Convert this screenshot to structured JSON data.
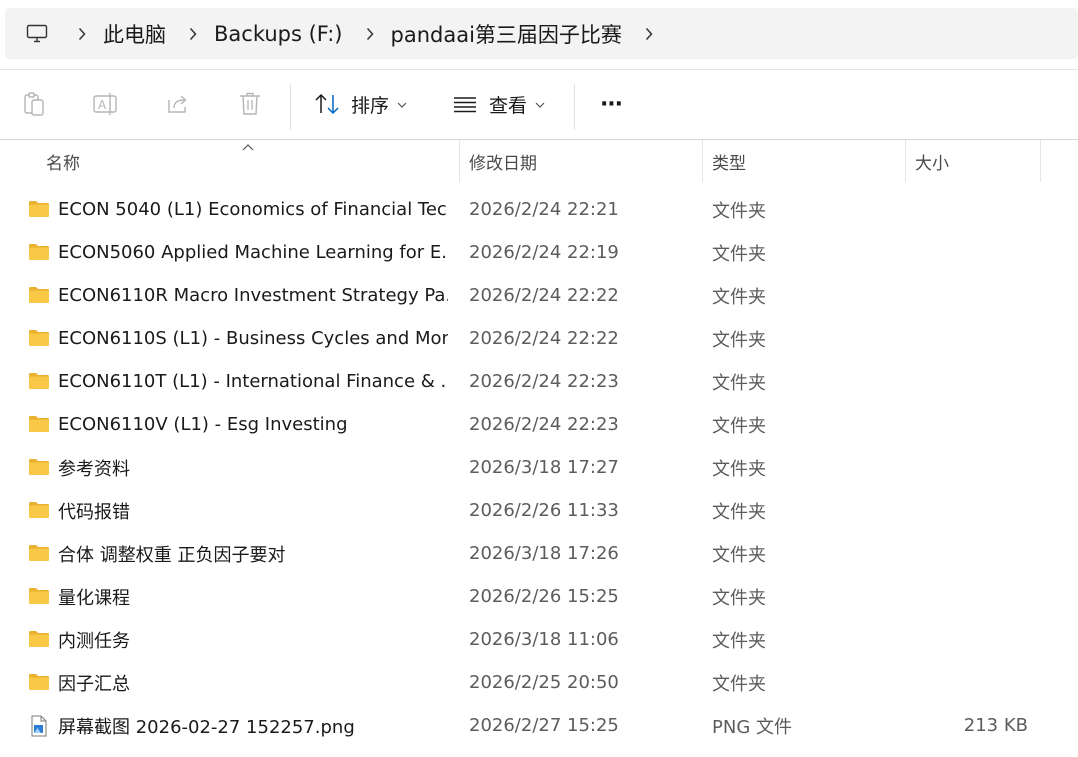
{
  "address": {
    "root_icon": "computer-icon",
    "crumbs": [
      "此电脑",
      "Backups (F:)",
      "pandaai第三届因子比赛"
    ]
  },
  "toolbar": {
    "copy_icon": "clipboard-icon",
    "rename_icon": "rename-icon",
    "share_icon": "share-icon",
    "delete_icon": "trash-icon",
    "sort_label": "排序",
    "view_label": "查看",
    "more_label": "···"
  },
  "columns": {
    "name": "名称",
    "date": "修改日期",
    "type": "类型",
    "size": "大小"
  },
  "files": [
    {
      "name": "ECON 5040 (L1) Economics of Financial Tec...",
      "date": "2026/2/24 22:21",
      "type": "文件夹",
      "size": "",
      "kind": "folder"
    },
    {
      "name": "ECON5060 Applied Machine Learning for E...",
      "date": "2026/2/24 22:19",
      "type": "文件夹",
      "size": "",
      "kind": "folder"
    },
    {
      "name": "ECON6110R Macro Investment Strategy Pa...",
      "date": "2026/2/24 22:22",
      "type": "文件夹",
      "size": "",
      "kind": "folder"
    },
    {
      "name": "ECON6110S (L1) - Business Cycles and Mon...",
      "date": "2026/2/24 22:22",
      "type": "文件夹",
      "size": "",
      "kind": "folder"
    },
    {
      "name": "ECON6110T (L1) - International Finance & ...",
      "date": "2026/2/24 22:23",
      "type": "文件夹",
      "size": "",
      "kind": "folder"
    },
    {
      "name": "ECON6110V (L1) - Esg Investing",
      "date": "2026/2/24 22:23",
      "type": "文件夹",
      "size": "",
      "kind": "folder"
    },
    {
      "name": "参考资料",
      "date": "2026/3/18 17:27",
      "type": "文件夹",
      "size": "",
      "kind": "folder"
    },
    {
      "name": "代码报错",
      "date": "2026/2/26 11:33",
      "type": "文件夹",
      "size": "",
      "kind": "folder"
    },
    {
      "name": "合体 调整权重 正负因子要对",
      "date": "2026/3/18 17:26",
      "type": "文件夹",
      "size": "",
      "kind": "folder"
    },
    {
      "name": "量化课程",
      "date": "2026/2/26 15:25",
      "type": "文件夹",
      "size": "",
      "kind": "folder"
    },
    {
      "name": "内测任务",
      "date": "2026/3/18 11:06",
      "type": "文件夹",
      "size": "",
      "kind": "folder"
    },
    {
      "name": "因子汇总",
      "date": "2026/2/25 20:50",
      "type": "文件夹",
      "size": "",
      "kind": "folder"
    },
    {
      "name": "屏幕截图 2026-02-27 152257.png",
      "date": "2026/2/27 15:25",
      "type": "PNG 文件",
      "size": "213 KB",
      "kind": "image"
    }
  ],
  "colors": {
    "folder": "#f8c846",
    "folder_tab": "#e9b12f",
    "accent": "#0067c0"
  }
}
